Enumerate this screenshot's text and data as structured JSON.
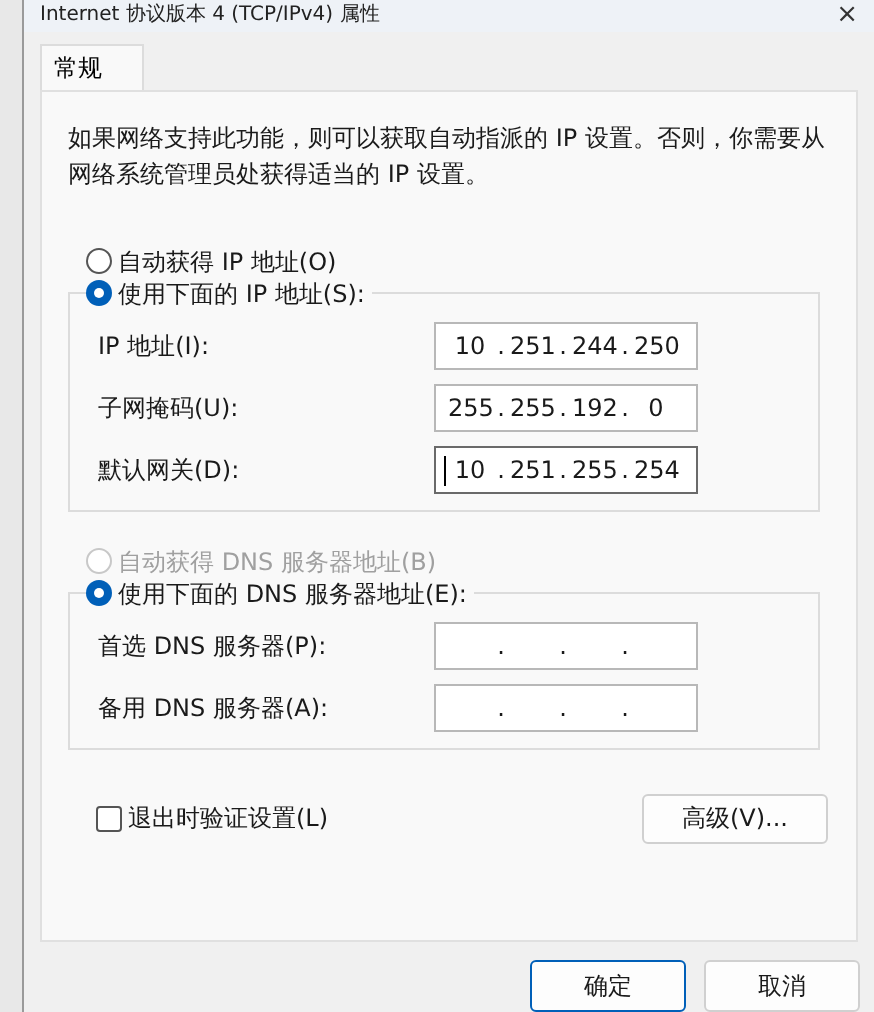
{
  "window": {
    "title": "Internet 协议版本 4 (TCP/IPv4) 属性",
    "close": "×"
  },
  "tabs": [
    {
      "label": "常规",
      "selected": true
    }
  ],
  "description": "如果网络支持此功能，则可以获取自动指派的 IP 设置。否则，你需要从网络系统管理员处获得适当的 IP 设置。",
  "separator": ".",
  "ip_section": {
    "options": [
      {
        "label": "自动获得 IP 地址(O)",
        "selected": false,
        "disabled": false
      },
      {
        "label": "使用下面的 IP 地址(S):",
        "selected": true,
        "disabled": false
      }
    ],
    "fields": [
      {
        "label": "IP 地址(I):",
        "octets": [
          "10",
          "251",
          "244",
          "250"
        ],
        "focused": false
      },
      {
        "label": "子网掩码(U):",
        "octets": [
          "255",
          "255",
          "192",
          "0"
        ],
        "focused": false
      },
      {
        "label": "默认网关(D):",
        "octets": [
          "10",
          "251",
          "255",
          "254"
        ],
        "focused": true
      }
    ]
  },
  "dns_section": {
    "options": [
      {
        "label": "自动获得 DNS 服务器地址(B)",
        "selected": false,
        "disabled": true
      },
      {
        "label": "使用下面的 DNS 服务器地址(E):",
        "selected": true,
        "disabled": false
      }
    ],
    "fields": [
      {
        "label": "首选 DNS 服务器(P):",
        "focused": false
      },
      {
        "label": "备用 DNS 服务器(A):",
        "focused": false
      }
    ]
  },
  "validate_on_exit": {
    "label": "退出时验证设置(L)",
    "checked": false
  },
  "advanced_button": "高级(V)...",
  "buttons": [
    {
      "label": "确定",
      "kind": "primary"
    },
    {
      "label": "取消",
      "kind": "secondary"
    }
  ]
}
